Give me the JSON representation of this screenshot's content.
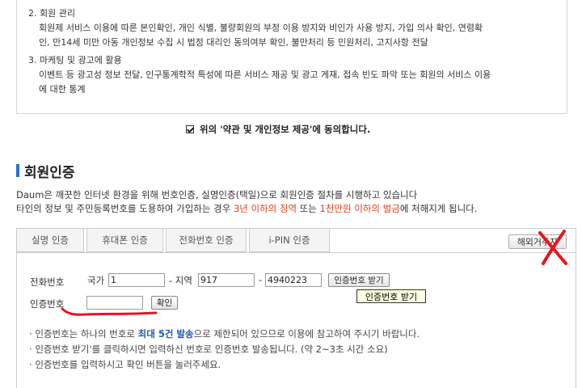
{
  "terms": [
    {
      "title": "2. 회원 관리",
      "body": [
        "회원제 서비스 이용에 따른 본인확인, 개인 식별, 불량회원의 부정 이용 방지와 비인가 사용 방지, 가입 의사 확인, 연령확",
        "인, 만14세 미만 아동 개인정보 수집 시 법정 대리인 동의여부 확인, 불만처리 등 민원처리, 고지사항 전달"
      ]
    },
    {
      "title": "3. 마케팅 및 광고에 활용",
      "body": [
        "이벤트 등 광고성 정보 전달, 인구통계학적 특성에 따른 서비스 제공 및 광고 게재, 접속 빈도 파악 또는 회원의 서비스 이용",
        "에 대한 통계"
      ]
    }
  ],
  "agree_label": "위의 '약관 및 개인정보 제공'에 동의합니다.",
  "section_title": "회원인증",
  "desc": {
    "line1": "Daum은 깨끗한 인터넷 환경을 위해 번호인증, 실명인증(택일)으로 회원인증 절차를 시행하고 있습니다",
    "line2_a": "타인의 정보 및 주민등록번호를 도용하여 가입하는 경우 ",
    "line2_red1": "3년 이하의 징역",
    "line2_b": " 또는 ",
    "line2_red2": "1천만원 이하의 벌금",
    "line2_c": "에 처해지게 됩니다."
  },
  "tabs": [
    "실명 인증",
    "휴대폰 인증",
    "전화번호 인증",
    "i-PIN 인증"
  ],
  "overseas_button": "해외거주자",
  "form": {
    "phone_label": "전화번호",
    "country_label": "국가",
    "country_value": "1",
    "area_label": "- 지역",
    "area_value": "917",
    "dash": "-",
    "number_value": "4940223",
    "request_button": "인증번호 받기",
    "tooltip": "인증번호 받기",
    "code_label": "인증번호",
    "code_value": "",
    "confirm_button": "확인"
  },
  "notes": {
    "n1_a": "인증번호는 하나의 번호로 ",
    "n1_hl": "최대 5건 발송",
    "n1_b": "으로 제한되어 있으므로 이용에 참고하여 주시기 바랍니다.",
    "n2": "인증번호 받기'를 클릭하시면 입력하신 번호로 인증번호 발송됩니다. (약 2~3초 시간 소요)",
    "n3": "인증번호를 입력하시고 확인 버튼을 눌러주세요."
  },
  "colors": {
    "accent": "#2b6fd1",
    "warning": "#e0411c",
    "annotation": "#e8141c"
  }
}
